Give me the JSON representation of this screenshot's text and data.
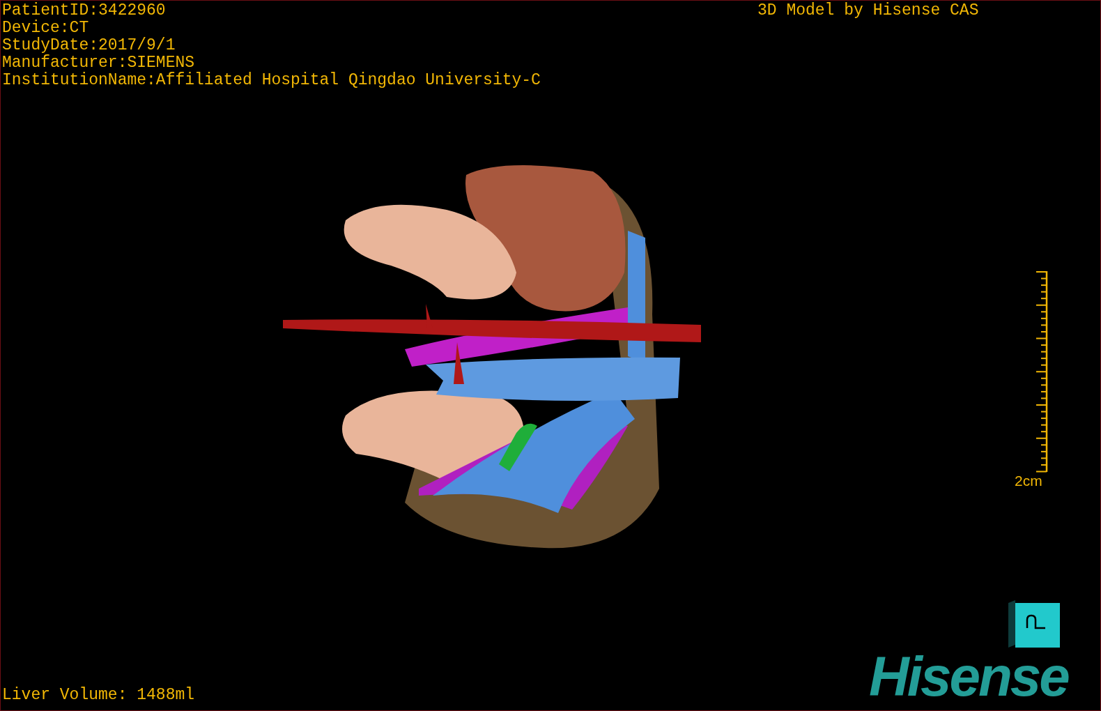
{
  "study_info": [
    "PatientID:3422960",
    "Device:CT",
    "StudyDate:2017/9/1",
    "Manufacturer:SIEMENS",
    "InstitutionName:Affiliated Hospital Qingdao University-C"
  ],
  "model_credit": "3D Model by Hisense CAS",
  "scale_bar": {
    "label": "2cm"
  },
  "liver_volume": "Liver Volume: 1488ml",
  "logo": "Hisense"
}
